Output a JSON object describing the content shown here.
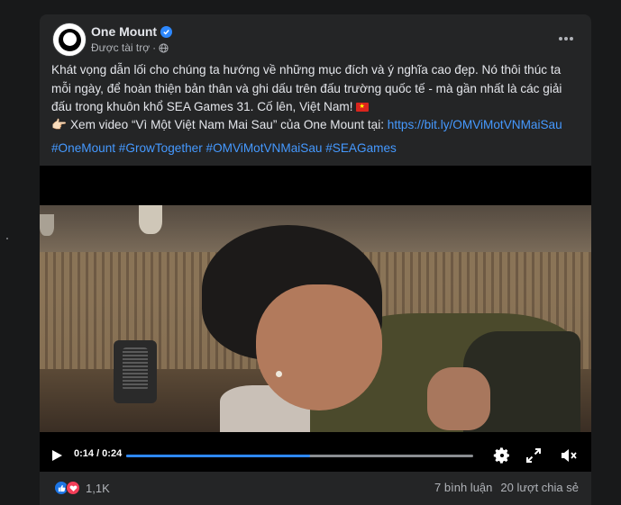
{
  "post": {
    "page_name": "One Mount",
    "sponsored_label": "Được tài trợ",
    "separator": "·",
    "more_icon": "more-horizontal-icon",
    "text_main": "Khát vọng dẫn lối cho chúng ta hướng về những mục đích và ý nghĩa cao đẹp. Nó thôi thúc ta mỗi ngày, để hoàn thiện bản thân và ghi dấu trên đấu trường quốc tế - mà gần nhất là các giải đấu trong khuôn khổ SEA Games 31. Cố lên, Việt Nam!",
    "hand_emoji": "👉🏻",
    "video_line_text": "Xem video “Vì Một Việt Nam Mai Sau” của One Mount tại: ",
    "video_link": "https://bit.ly/OMViMotVNMaiSau",
    "hashtags": "#OneMount #GrowTogether #OMViMotVNMaiSau #SEAGames"
  },
  "video": {
    "time": "0:14 / 0:24",
    "progress": 0.53
  },
  "stats": {
    "reaction_count": "1,1K",
    "comments": "7 bình luận",
    "shares": "20 lượt chia sẻ"
  },
  "colors": {
    "card_bg": "#242526",
    "link": "#4599ff",
    "verified": "#2d88ff",
    "like": "#1b74e4",
    "love": "#f33e58"
  }
}
